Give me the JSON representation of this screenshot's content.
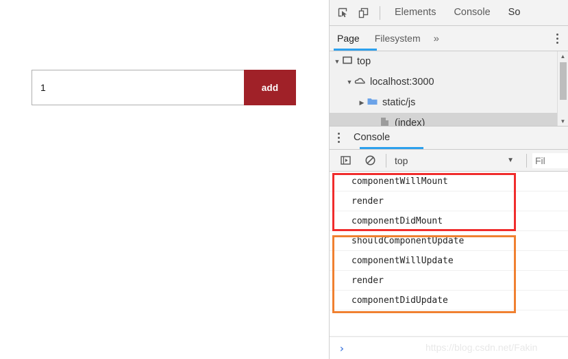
{
  "page": {
    "input_value": "1",
    "input_placeholder": "",
    "add_label": "add",
    "add_color": "#a02128"
  },
  "devtools": {
    "accent_color": "#2ca0ed",
    "toolbar": {
      "inspect_icon": "inspect-element-icon",
      "device_icon": "device-toolbar-icon"
    },
    "tabs": [
      {
        "label": "Elements",
        "active": false
      },
      {
        "label": "Console",
        "active": false
      },
      {
        "label": "So",
        "active": true
      }
    ],
    "navigator": {
      "tabs": [
        {
          "label": "Page",
          "active": true
        },
        {
          "label": "Filesystem",
          "active": false
        }
      ],
      "more_label": "»",
      "kebab_icon": "more-options-icon",
      "tree": [
        {
          "label": "top",
          "twisty": "▼",
          "icon": "frame-icon",
          "indent": 4,
          "selected": false
        },
        {
          "label": "localhost:3000",
          "twisty": "▼",
          "icon": "cloud-icon",
          "indent": 22,
          "selected": false
        },
        {
          "label": "static/js",
          "twisty": "▶",
          "icon": "folder-icon",
          "indent": 40,
          "selected": false
        },
        {
          "label": "(index)",
          "twisty": "",
          "icon": "document-icon",
          "indent": 58,
          "selected": true
        }
      ],
      "scrollbar": {
        "up_arrow": "▲",
        "down_arrow": "▼"
      }
    },
    "drawer": {
      "kebab_icon": "more-options-icon",
      "console_tab_label": "Console",
      "toolbar": {
        "sidebar_icon": "console-sidebar-icon",
        "clear_icon": "clear-console-icon",
        "context_value": "top",
        "context_caret": "▼",
        "filter_placeholder": "Fil"
      },
      "messages": [
        {
          "text": "componentWillMount",
          "group": "mount"
        },
        {
          "text": "render",
          "group": "mount"
        },
        {
          "text": "componentDidMount",
          "group": "mount"
        },
        {
          "text": "shouldComponentUpdate",
          "group": "update"
        },
        {
          "text": "componentWillUpdate",
          "group": "update"
        },
        {
          "text": "render",
          "group": "update"
        },
        {
          "text": "componentDidUpdate",
          "group": "update"
        }
      ],
      "annotations": {
        "mount_box_color": "#f02c2c",
        "update_box_color": "#f08030"
      },
      "prompt": {
        "caret": "›",
        "value": ""
      }
    }
  },
  "watermark": "https://blog.csdn.net/Fakin"
}
